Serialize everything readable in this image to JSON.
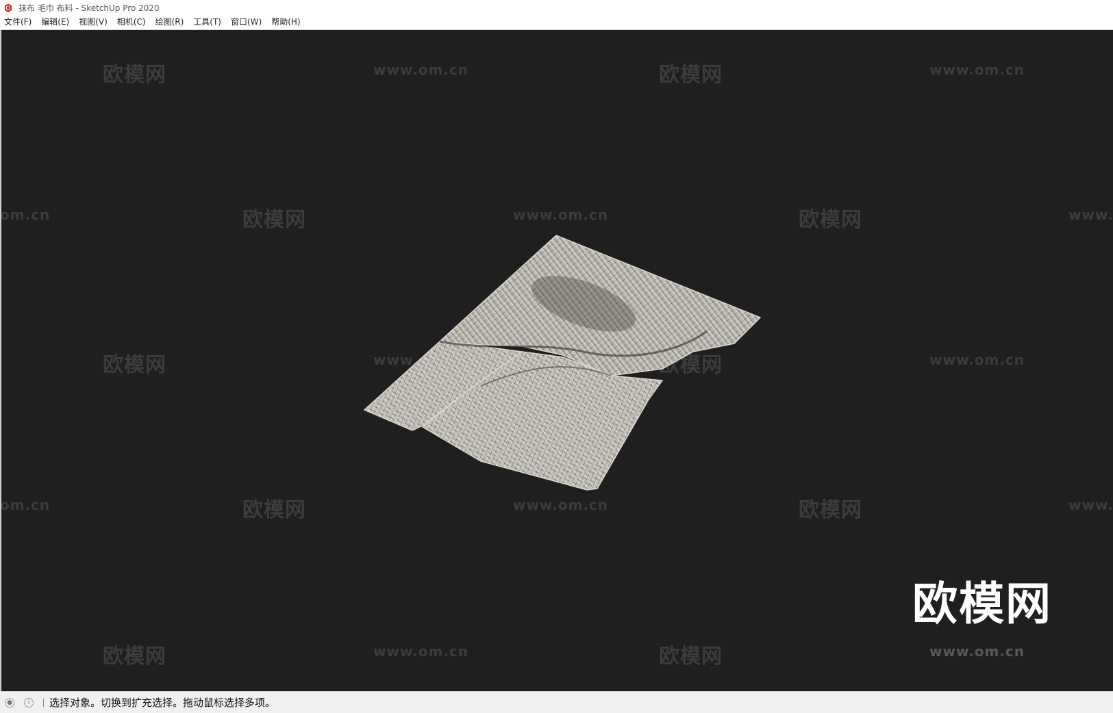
{
  "window": {
    "title": "抹布 毛巾 布料 - SketchUp Pro 2020",
    "icon": "sketchup-logo-icon"
  },
  "menu": {
    "items": [
      {
        "label": "文件(F)"
      },
      {
        "label": "编辑(E)"
      },
      {
        "label": "视图(V)"
      },
      {
        "label": "相机(C)"
      },
      {
        "label": "绘图(R)"
      },
      {
        "label": "工具(T)"
      },
      {
        "label": "窗口(W)"
      },
      {
        "label": "帮助(H)"
      }
    ]
  },
  "viewport": {
    "background": "#1f1f1f",
    "model": "cloth-towel-mesh",
    "watermark": {
      "cn": "欧模网",
      "url": "www.om.cn",
      "url_left": "om.cn",
      "url_right": "www.",
      "logo": "欧模网",
      "logo_url": "www.om.cn"
    }
  },
  "statusbar": {
    "icons": [
      "geo-location-icon",
      "info-icon"
    ],
    "message": "选择对象。切换到扩充选择。拖动鼠标选择多项。"
  }
}
